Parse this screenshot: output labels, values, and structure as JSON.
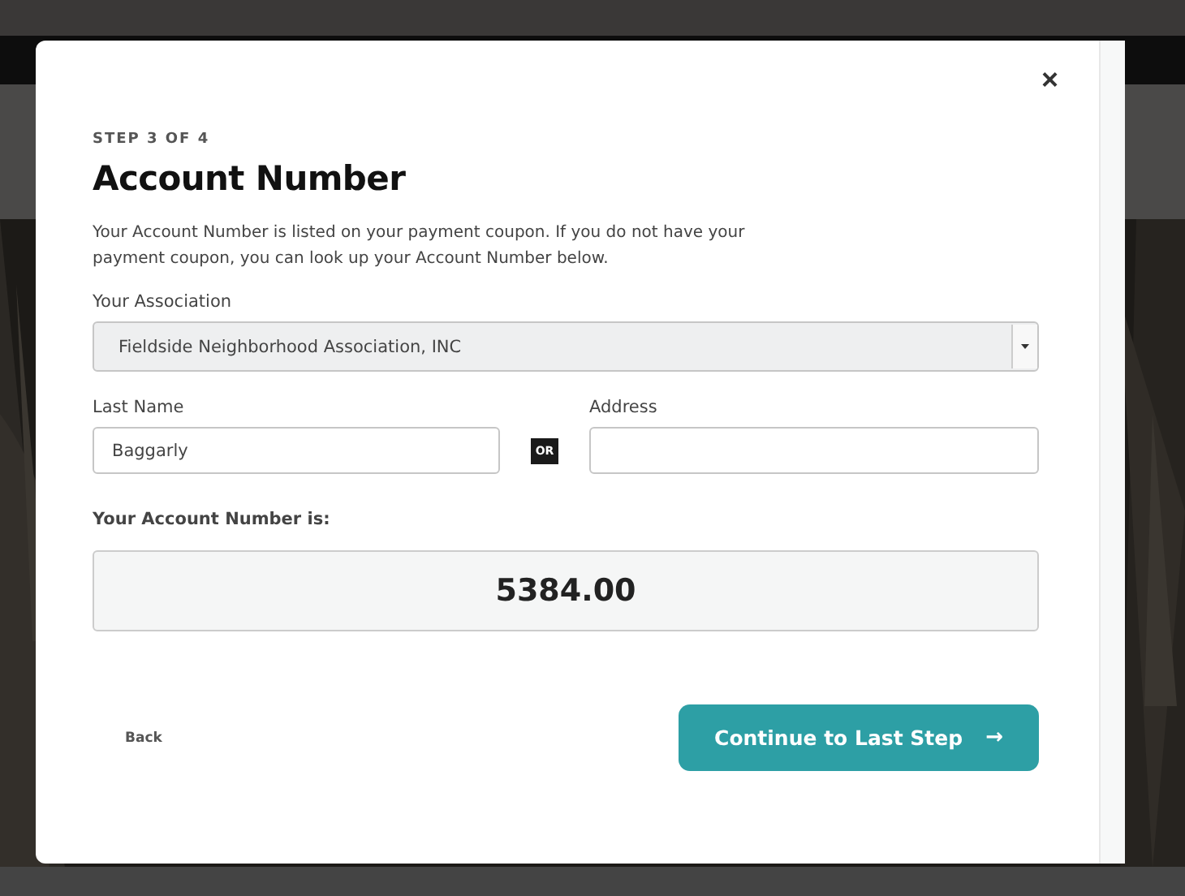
{
  "modal": {
    "step": "STEP 3 OF 4",
    "title": "Account Number",
    "close": "×",
    "intro": "Your Account Number is listed on your payment coupon. If you do not have your payment coupon, you can look up your Account Number below.",
    "association": {
      "label": "Your Association",
      "value": "Fieldside Neighborhood Association, INC"
    },
    "last_name": {
      "label": "Last Name",
      "value": "Baggarly"
    },
    "separator": "OR",
    "address": {
      "label": "Address"
    },
    "result": {
      "label": "Your Account Number is:",
      "value": "5384.00"
    },
    "back": "Back",
    "continue": {
      "label": "Continue to Last Step",
      "arrow": "→"
    }
  }
}
